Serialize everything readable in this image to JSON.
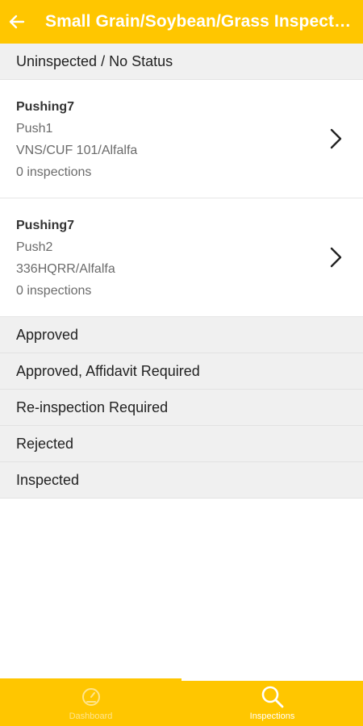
{
  "header": {
    "title": "Small Grain/Soybean/Grass Inspections"
  },
  "sections": [
    {
      "label": "Uninspected / No Status"
    },
    {
      "label": "Approved"
    },
    {
      "label": "Approved, Affidavit Required"
    },
    {
      "label": "Re-inspection Required"
    },
    {
      "label": "Rejected"
    },
    {
      "label": "Inspected"
    }
  ],
  "items": [
    {
      "grower": "Pushing7",
      "field": "Push1",
      "variety": "VNS/CUF 101/Alfalfa",
      "inspections": "0 inspections"
    },
    {
      "grower": "Pushing7",
      "field": "Push2",
      "variety": "336HQRR/Alfalfa",
      "inspections": "0 inspections"
    }
  ],
  "bottom_nav": {
    "dashboard_label": "Dashboard",
    "inspections_label": "Inspections",
    "active": "inspections"
  },
  "colors": {
    "accent": "#FFC600",
    "section_bg": "#f0f0f0"
  },
  "icons": {
    "back": "arrow-left-icon",
    "chevron": "chevron-right-icon",
    "dashboard": "gauge-icon",
    "inspections": "search-icon"
  }
}
